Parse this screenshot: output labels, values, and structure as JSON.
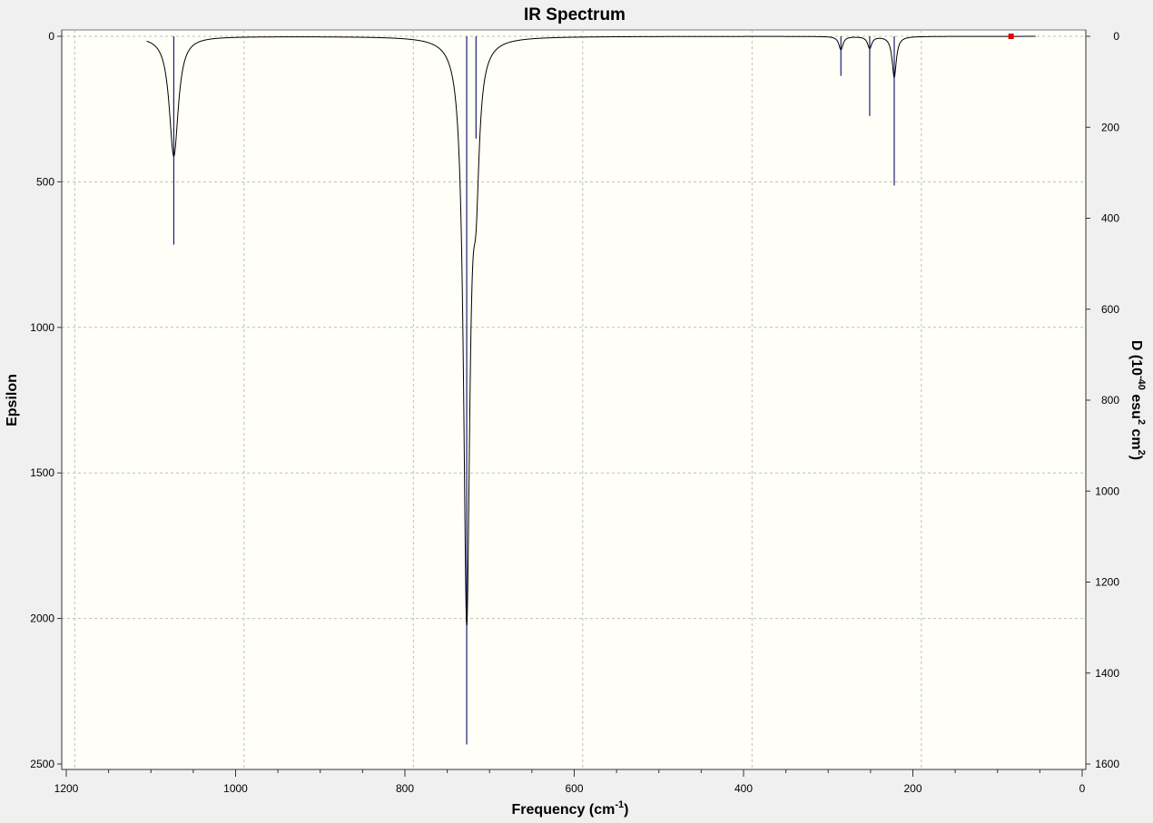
{
  "chart_data": {
    "type": "line",
    "title": "IR Spectrum",
    "xlabel": {
      "base": "Frequency (cm",
      "sup": "-1",
      "tail": ")"
    },
    "ylabel": "Epsilon",
    "y2label": {
      "p1": "D (10",
      "sup1": "-40",
      "p2": " esu",
      "sup2": "2",
      "p3": " cm",
      "sup3": "2",
      "p4": ")"
    },
    "xlim": [
      1200,
      0
    ],
    "ylim": [
      0,
      2500
    ],
    "y2lim": [
      0,
      1600
    ],
    "x_major_ticks": [
      1200,
      1000,
      800,
      600,
      400,
      200,
      0
    ],
    "x_minor_step": 50,
    "y_major_ticks": [
      0,
      500,
      1000,
      1500,
      2000,
      2500
    ],
    "y2_major_ticks": [
      0,
      200,
      400,
      600,
      800,
      1000,
      1200,
      1400,
      1600
    ],
    "x_gridlines": [
      1190,
      990,
      790,
      590,
      390,
      190
    ],
    "y_gridlines": [
      0,
      500,
      1000,
      1500,
      2000
    ],
    "grid": true,
    "invert_y": true,
    "spectrum_x_range": [
      1105,
      55
    ],
    "series": [
      {
        "kind": "curve",
        "color": "#000000",
        "peaks": [
          {
            "x": 1073,
            "y": 412,
            "hwhm": 6.5
          },
          {
            "x": 727,
            "y": 1968,
            "hwhm": 4.5
          },
          {
            "x": 716,
            "y": 390,
            "hwhm": 4.5
          },
          {
            "x": 285,
            "y": 45,
            "hwhm": 3.0
          },
          {
            "x": 251,
            "y": 40,
            "hwhm": 3.0
          },
          {
            "x": 222,
            "y": 140,
            "hwhm": 3.0
          }
        ]
      },
      {
        "kind": "sticks",
        "axis": "y2",
        "color": "#1a1f6e",
        "sticks": [
          {
            "x": 1073,
            "d": 458
          },
          {
            "x": 727,
            "d": 1557
          },
          {
            "x": 716,
            "d": 225
          },
          {
            "x": 285,
            "d": 87
          },
          {
            "x": 251,
            "d": 175
          },
          {
            "x": 222,
            "d": 328
          },
          {
            "x": 84,
            "d": 0
          }
        ]
      }
    ],
    "marker": {
      "x": 84,
      "y": 0,
      "color": "#e00000"
    }
  }
}
